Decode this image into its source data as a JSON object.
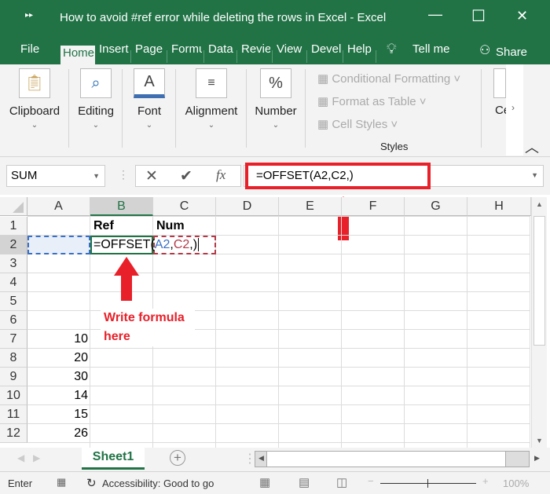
{
  "window": {
    "title": "How to avoid #ref error while deleting the rows in Excel  -  Excel",
    "minimize": "—",
    "maximize": "☐",
    "close": "✕",
    "qat": "▸▸"
  },
  "tabs": [
    {
      "label": "File"
    },
    {
      "label": "Home"
    },
    {
      "label": "Insert"
    },
    {
      "label": "Page"
    },
    {
      "label": "Formu"
    },
    {
      "label": "Data"
    },
    {
      "label": "Revie"
    },
    {
      "label": "View"
    },
    {
      "label": "Devel"
    },
    {
      "label": "Help"
    }
  ],
  "tell_me": "Tell me",
  "share": "Share",
  "ribbon": {
    "groups": [
      {
        "label": "Clipboard",
        "icon": "clipboard-icon"
      },
      {
        "label": "Editing",
        "icon": "search-icon"
      },
      {
        "label": "Font",
        "icon": "font-icon"
      },
      {
        "label": "Alignment",
        "icon": "align-icon"
      },
      {
        "label": "Number",
        "icon": "percent-icon"
      }
    ],
    "styles": {
      "items": [
        "Conditional Formatting",
        "Format as Table",
        "Cell Styles"
      ],
      "label": "Styles"
    },
    "cells_label": "Ce"
  },
  "formula_bar": {
    "name_box": "SUM",
    "formula": "=OFFSET(A2,C2,)",
    "fx": "fx"
  },
  "columns": [
    "A",
    "B",
    "C",
    "D",
    "E",
    "F",
    "G",
    "H"
  ],
  "rows": [
    "1",
    "2",
    "3",
    "4",
    "5",
    "6",
    "7",
    "8",
    "9",
    "10",
    "11",
    "12"
  ],
  "cells": {
    "B1": "Ref",
    "C1": "Num",
    "A7": "10",
    "A8": "20",
    "A9": "30",
    "A10": "14",
    "A11": "15",
    "A12": "26"
  },
  "edit_cell": {
    "prefix": "=OFFSET(",
    "ref1": "A2",
    "comma1": ",",
    "ref2": "C2",
    "suffix": ",)"
  },
  "annotation": {
    "line1": "Write formula",
    "line2": "here"
  },
  "sheets": [
    {
      "label": "Sheet1"
    }
  ],
  "status": {
    "mode": "Enter",
    "accessibility": "Accessibility: Good to go",
    "zoom": "100%"
  },
  "colors": {
    "excel_green": "#217346",
    "annotation_red": "#e8202a",
    "ref_blue": "#3a6fc4",
    "ref_red": "#b23a48"
  }
}
